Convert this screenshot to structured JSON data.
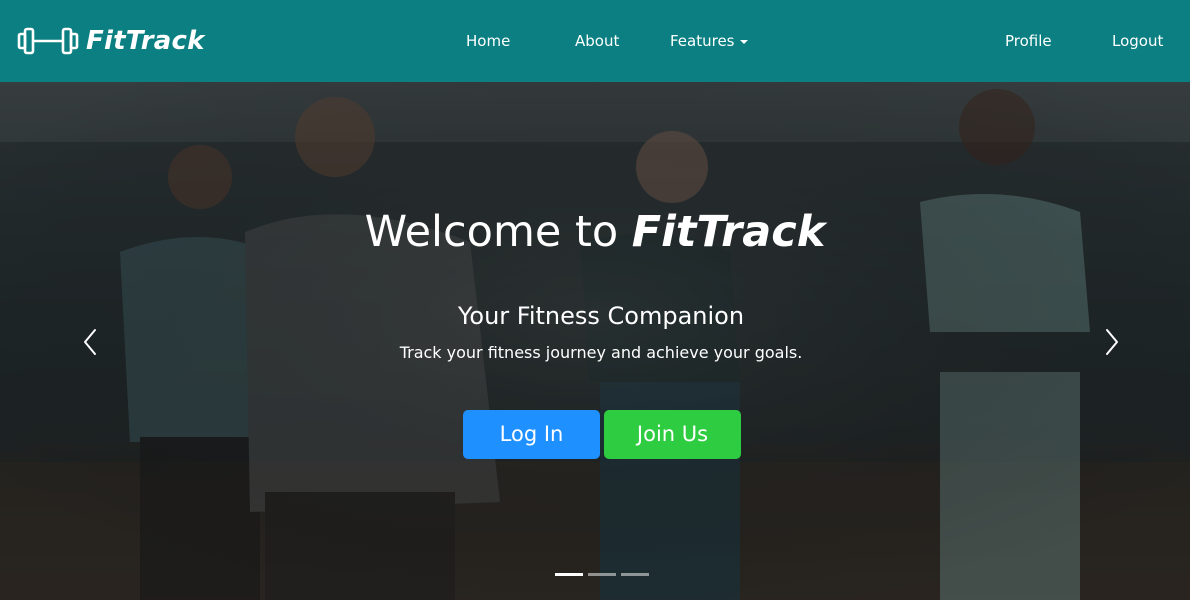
{
  "navbar": {
    "brand": "FitTrack",
    "brand_icon": "dumbbell-icon",
    "background": "#0b7f81",
    "links": {
      "home": "Home",
      "about": "About",
      "features": "Features",
      "profile": "Profile",
      "logout": "Logout"
    }
  },
  "hero": {
    "title_prefix": "Welcome to",
    "title_brand": "FitTrack",
    "subtitle": "Your Fitness Companion",
    "tagline": "Track your fitness journey and achieve your goals.",
    "login_label": "Log In",
    "join_label": "Join Us",
    "login_color": "#1e90ff",
    "join_color": "#2ecc40",
    "prev_icon": "chevron-left-icon",
    "next_icon": "chevron-right-icon",
    "slides": 3,
    "active_slide": 1
  }
}
